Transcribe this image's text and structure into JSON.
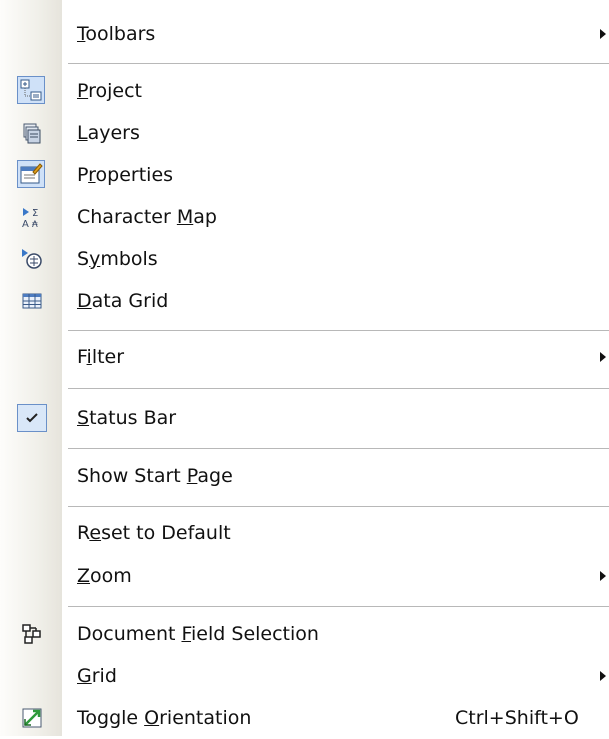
{
  "menu": {
    "toolbars": {
      "pre": "",
      "key": "T",
      "post": "oolbars"
    },
    "project": {
      "pre": "",
      "key": "P",
      "post": "roject"
    },
    "layers": {
      "pre": "",
      "key": "L",
      "post": "ayers"
    },
    "properties": {
      "pre": "P",
      "key": "r",
      "post": "operties"
    },
    "character_map": {
      "pre": "Character ",
      "key": "M",
      "post": "ap"
    },
    "symbols": {
      "pre": "S",
      "key": "y",
      "post": "mbols"
    },
    "data_grid": {
      "pre": "",
      "key": "D",
      "post": "ata Grid"
    },
    "filter": {
      "pre": "F",
      "key": "i",
      "post": "lter"
    },
    "status_bar": {
      "pre": "",
      "key": "S",
      "post": "tatus Bar"
    },
    "show_start_page": {
      "pre": "Show Start ",
      "key": "P",
      "post": "age"
    },
    "reset_to_default": {
      "pre": "R",
      "key": "e",
      "post": "set to Default"
    },
    "zoom": {
      "pre": "",
      "key": "Z",
      "post": "oom"
    },
    "document_field_selection": {
      "pre": "Document ",
      "key": "F",
      "post": "ield Selection"
    },
    "grid": {
      "pre": "",
      "key": "G",
      "post": "rid"
    },
    "toggle_orientation": {
      "pre": "Toggle ",
      "key": "O",
      "post": "rientation",
      "shortcut": "Ctrl+Shift+O"
    }
  },
  "icons": {
    "project": "project-icon",
    "layers": "layers-icon",
    "properties": "properties-icon",
    "character_map": "character-map-icon",
    "symbols": "symbols-icon",
    "data_grid": "data-grid-icon",
    "status_bar": "checkmark-icon",
    "document_field_selection": "field-selection-icon",
    "toggle_orientation": "toggle-orientation-icon"
  },
  "colors": {
    "highlight_border": "#6a90c8",
    "highlight_fill": "#cfe1f8",
    "separator": "#b8b8b8"
  }
}
